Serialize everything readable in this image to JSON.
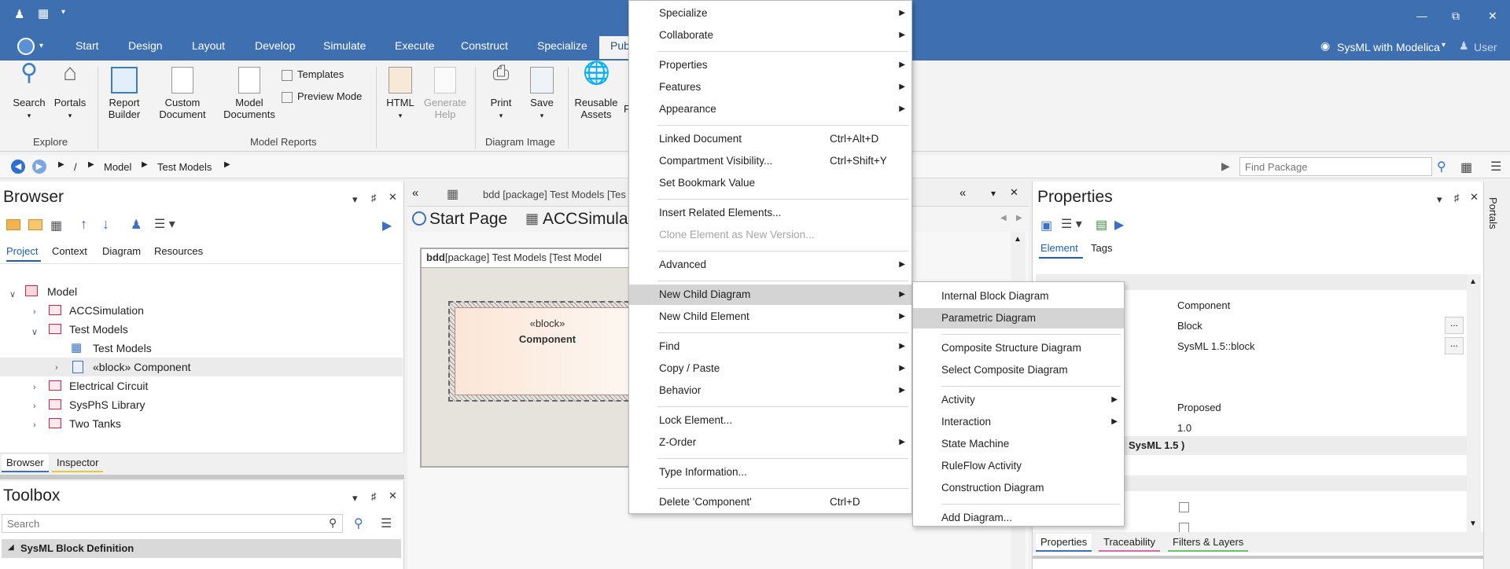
{
  "window": {
    "ribbon_tabs": [
      "Start",
      "Design",
      "Layout",
      "Develop",
      "Simulate",
      "Execute",
      "Construct",
      "Specialize",
      "Pub"
    ],
    "perspective": "SysML with Modelica",
    "user": "User"
  },
  "ribbon": {
    "explore": {
      "search": "Search",
      "portals": "Portals",
      "group": "Explore"
    },
    "reports": {
      "report_builder": "Report Builder",
      "custom_document": "Custom Document",
      "model_documents": "Model Documents",
      "templates": "Templates",
      "preview_mode": "Preview Mode",
      "group": "Model Reports"
    },
    "html": {
      "html": "HTML",
      "generate_help": "Generate Help"
    },
    "image": {
      "print": "Print",
      "save": "Save",
      "group": "Diagram Image"
    },
    "assets": {
      "reusable_assets": "Reusable Assets",
      "partial": "F"
    }
  },
  "addressbar": {
    "root": "/",
    "path": [
      "Model",
      "Test Models"
    ],
    "find_placeholder": "Find Package"
  },
  "browser": {
    "title": "Browser",
    "tabs": [
      "Project",
      "Context",
      "Diagram",
      "Resources"
    ],
    "tree": {
      "root": "Model",
      "acc": "ACCSimulation",
      "test_models": "Test Models",
      "test_models_diagram": "Test Models",
      "component": "«block» Component",
      "electrical": "Electrical Circuit",
      "sysphs": "SysPhS Library",
      "two_tanks": "Two Tanks"
    },
    "bottom_tabs": [
      "Browser",
      "Inspector"
    ]
  },
  "toolbox": {
    "title": "Toolbox",
    "search_placeholder": "Search",
    "section": "SysML Block Definition"
  },
  "diagram": {
    "header_title": "bdd [package] Test Models [Tes",
    "doc_tabs": [
      "Start Page",
      "ACCSimula"
    ],
    "frame_label_bold": "bdd",
    "frame_label": "[package] Test Models [Test Model",
    "block_stereotype": "«block»",
    "block_name": "Component"
  },
  "properties": {
    "title": "Properties",
    "tabs": [
      "Element",
      "Tags"
    ],
    "values": [
      "Component",
      "Block",
      "SysML 1.5::block",
      "Proposed",
      "1.0"
    ],
    "section": "SysML 1.5 )",
    "bottom_tabs": [
      "Properties",
      "Traceability",
      "Filters & Layers"
    ],
    "side_tab": "Portals"
  },
  "context_menu": [
    {
      "label": "Specialize",
      "arrow": true
    },
    {
      "label": "Collaborate",
      "arrow": true
    },
    {
      "label": "Properties",
      "arrow": true
    },
    {
      "label": "Features",
      "arrow": true
    },
    {
      "label": "Appearance",
      "arrow": true
    },
    {
      "label": "Linked Document",
      "shortcut": "Ctrl+Alt+D"
    },
    {
      "label": "Compartment Visibility...",
      "shortcut": "Ctrl+Shift+Y"
    },
    {
      "label": "Set Bookmark Value"
    },
    {
      "label": "Insert Related Elements..."
    },
    {
      "label": "Clone Element as New Version..."
    },
    {
      "label": "Advanced",
      "arrow": true
    },
    {
      "label": "New Child Diagram",
      "arrow": true
    },
    {
      "label": "New Child Element",
      "arrow": true
    },
    {
      "label": "Find",
      "arrow": true
    },
    {
      "label": "Copy / Paste",
      "arrow": true
    },
    {
      "label": "Behavior",
      "arrow": true
    },
    {
      "label": "Lock Element..."
    },
    {
      "label": "Z-Order",
      "arrow": true
    },
    {
      "label": "Type Information..."
    },
    {
      "label": "Delete 'Component'",
      "shortcut": "Ctrl+D"
    }
  ],
  "submenu": [
    {
      "label": "Internal Block Diagram"
    },
    {
      "label": "Parametric Diagram"
    },
    {
      "label": "Composite Structure Diagram"
    },
    {
      "label": "Select Composite Diagram"
    },
    {
      "label": "Activity",
      "arrow": true
    },
    {
      "label": "Interaction",
      "arrow": true
    },
    {
      "label": "State Machine"
    },
    {
      "label": "RuleFlow Activity"
    },
    {
      "label": "Construction Diagram"
    },
    {
      "label": "Add Diagram..."
    }
  ],
  "colors": {
    "titlebar": "#3e6fb0",
    "menu_highlight": "#d4d4d4",
    "accent": "#2f6fd0"
  }
}
